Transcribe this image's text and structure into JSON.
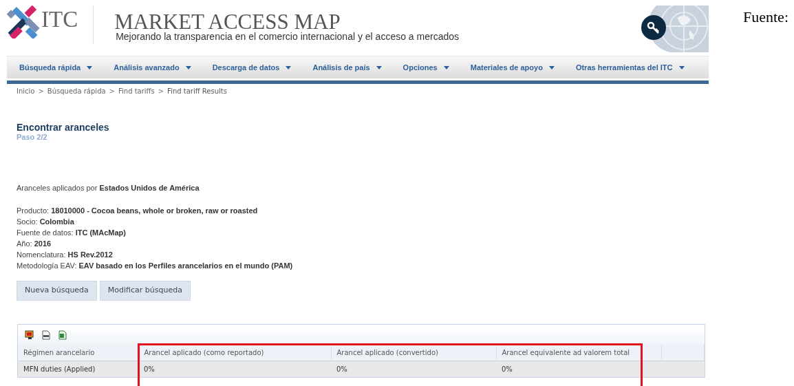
{
  "header": {
    "logo_text": "ITC",
    "title": "MARKET ACCESS MAP",
    "subtitle": "Mejorando la transparencia en el comercio internacional y el acceso a mercados"
  },
  "caption": "Fuente:",
  "nav": [
    {
      "label": "Búsqueda rápida"
    },
    {
      "label": "Análisis avanzado"
    },
    {
      "label": "Descarga de datos"
    },
    {
      "label": "Análisis de país"
    },
    {
      "label": "Opciones"
    },
    {
      "label": "Materiales de apoyo"
    },
    {
      "label": "Otras herramientas del ITC"
    }
  ],
  "breadcrumb": [
    {
      "kind": "link",
      "text": "Inicio"
    },
    {
      "kind": "separator",
      "text": ">"
    },
    {
      "kind": "link",
      "text": "Búsqueda rápida"
    },
    {
      "kind": "separator",
      "text": ">"
    },
    {
      "kind": "link",
      "text": "Find tariffs"
    },
    {
      "kind": "separator",
      "text": ">"
    },
    {
      "kind": "current",
      "text": "Find tariff Results"
    }
  ],
  "heading": "Encontrar aranceles",
  "step": "Paso 2/2",
  "applied_by": {
    "label": "Aranceles aplicados por",
    "value": "Estados Unidos de América"
  },
  "details": [
    {
      "label": "Producto:",
      "value": "18010000 - Cocoa beans, whole or broken, raw or roasted"
    },
    {
      "label": "Socio:",
      "value": "Colombia"
    },
    {
      "label": "Fuente de datos:",
      "value": "ITC (MAcMap)"
    },
    {
      "label": "Año:",
      "value": "2016"
    },
    {
      "label": "Nomenclatura:",
      "value": "HS Rev.2012"
    },
    {
      "label": "Metodología EAV:",
      "value": "EAV basado en los Perfiles arancelarios en el mundo (PAM)"
    }
  ],
  "buttons": [
    "Nueva búsqueda",
    "Modificar búsqueda"
  ],
  "table": {
    "columns": [
      "Régimen arancelario",
      "Arancel aplicado (como reportado)",
      "Arancel aplicado (convertido)",
      "Arancel equivalente ad valorem total"
    ],
    "rows": [
      [
        "MFN duties (Applied)",
        "0%",
        "0%",
        "0%"
      ]
    ]
  }
}
